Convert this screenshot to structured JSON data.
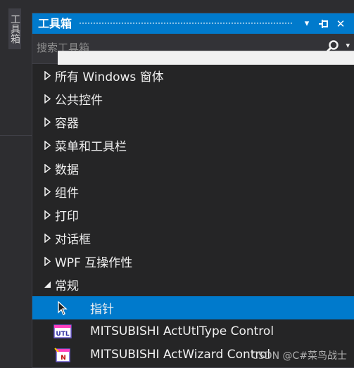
{
  "rail": {
    "tab_label": "工具箱"
  },
  "panel": {
    "title": "工具箱",
    "buttons": {
      "dropdown": "▾",
      "pin": "⊣",
      "close": "✕"
    },
    "search_placeholder": "搜索工具箱"
  },
  "categories": [
    {
      "label": "所有 Windows 窗体",
      "state": "collapsed"
    },
    {
      "label": "公共控件",
      "state": "collapsed"
    },
    {
      "label": "容器",
      "state": "collapsed"
    },
    {
      "label": "菜单和工具栏",
      "state": "collapsed"
    },
    {
      "label": "数据",
      "state": "collapsed"
    },
    {
      "label": "组件",
      "state": "collapsed"
    },
    {
      "label": "打印",
      "state": "collapsed"
    },
    {
      "label": "对话框",
      "state": "collapsed"
    },
    {
      "label": "WPF 互操作性",
      "state": "collapsed"
    },
    {
      "label": "常规",
      "state": "expanded"
    }
  ],
  "items": [
    {
      "label": "指针",
      "icon": "pointer-icon",
      "selected": true
    },
    {
      "label": "MITSUBISHI ActUtlType Control",
      "icon": "utl-control-icon",
      "selected": false
    },
    {
      "label": "MITSUBISHI ActWizard Control",
      "icon": "wizard-control-icon",
      "selected": false
    }
  ],
  "watermark": "CSDN @C#菜鸟战士",
  "colors": {
    "accent": "#007acc",
    "panel_bg": "#252526",
    "text": "#f1f1f1"
  }
}
